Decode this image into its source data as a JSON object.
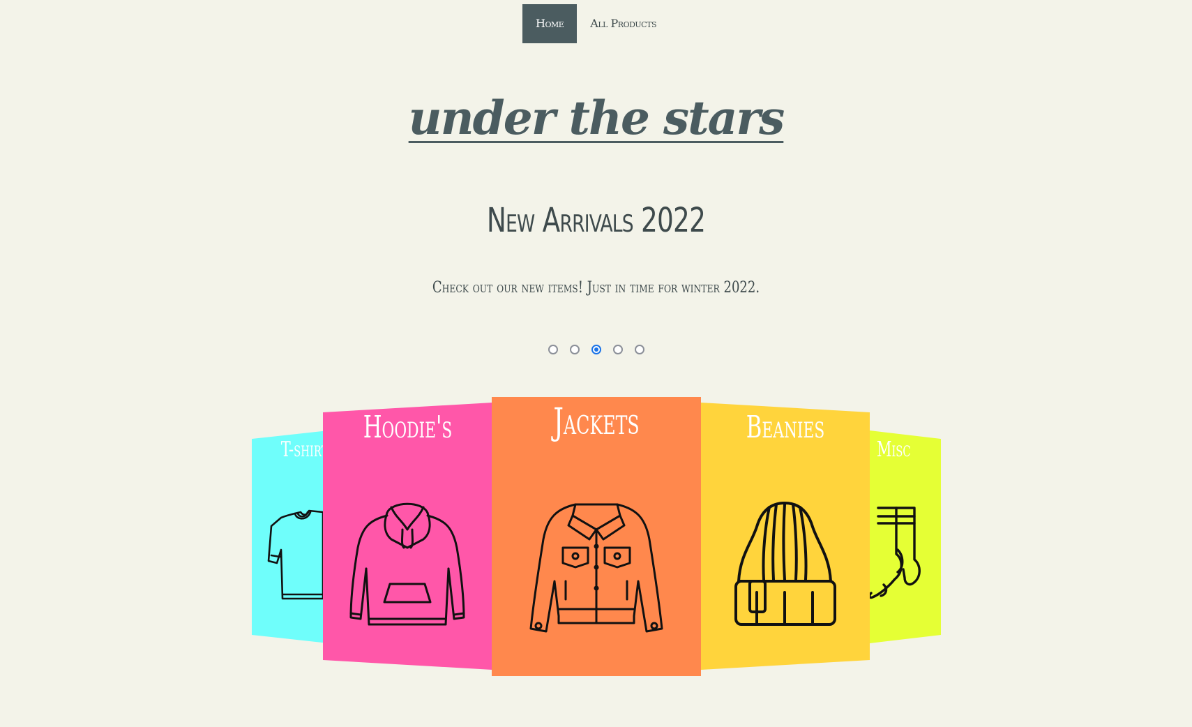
{
  "nav": {
    "items": [
      {
        "label": "Home",
        "active": true
      },
      {
        "label": "All Products",
        "active": false
      }
    ]
  },
  "brand": {
    "title": "under the stars"
  },
  "hero": {
    "heading": "New Arrivals 2022",
    "subheading": "Check out our new items! Just in time for winter 2022."
  },
  "carousel": {
    "active_index": 2,
    "dot_count": 5
  },
  "cards": [
    {
      "label": "T-shirt",
      "color": "#6ffefb",
      "icon": "tshirt-icon"
    },
    {
      "label": "Hoodie's",
      "color": "#ff57a9",
      "icon": "hoodie-icon"
    },
    {
      "label": "Jackets",
      "color": "#ff884d",
      "icon": "jacket-icon"
    },
    {
      "label": "Beanies",
      "color": "#ffd43c",
      "icon": "beanie-icon"
    },
    {
      "label": "Misc",
      "color": "#e5ff35",
      "icon": "socks-icon"
    }
  ],
  "colors": {
    "background": "#f3f3e9",
    "nav_active": "#4b5c60",
    "text": "#3e4a4c",
    "dot_active": "#1a73e8"
  }
}
